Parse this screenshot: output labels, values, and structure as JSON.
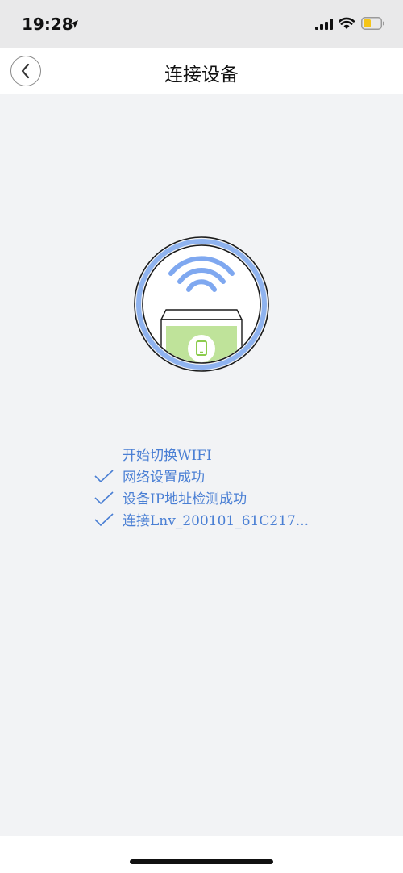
{
  "status_bar": {
    "time": "19:28",
    "icons": [
      "location-arrow-icon",
      "cellular-signal-icon",
      "wifi-icon",
      "battery-low-icon"
    ],
    "battery_color": "#f5c518"
  },
  "nav": {
    "title": "连接设备",
    "back_icon": "chevron-left-icon"
  },
  "illustration": {
    "icons": [
      "wifi-waves-icon",
      "phone-icon"
    ],
    "ring_color": "#8fb3ef",
    "screen_color": "#bfe39a",
    "wifi_color": "#7fa8f0"
  },
  "steps": [
    {
      "label": "开始切换WIFI",
      "done": false
    },
    {
      "label": "网络设置成功",
      "done": true
    },
    {
      "label": "设备IP地址检测成功",
      "done": true
    },
    {
      "label": "连接Lnv_200101_61C217...",
      "done": true
    }
  ],
  "colors": {
    "accent": "#4a7fd4",
    "background": "#f2f3f5"
  }
}
